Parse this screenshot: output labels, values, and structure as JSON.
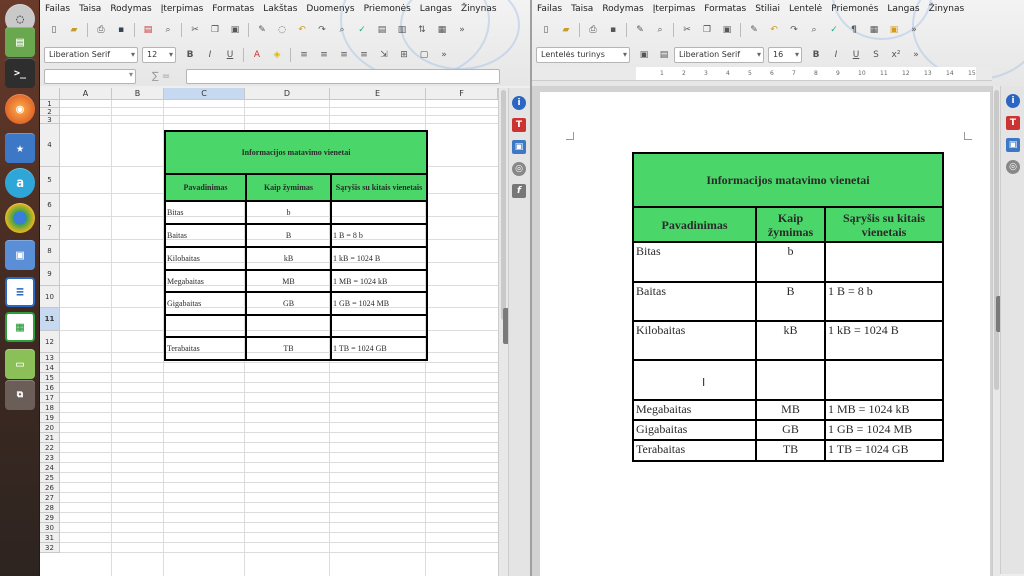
{
  "calc": {
    "menu": [
      "Failas",
      "Taisa",
      "Rodymas",
      "Įterpimas",
      "Formatas",
      "Lakštas",
      "Duomenys",
      "Priemonės",
      "Langas",
      "Žinynas"
    ],
    "font_name": "Liberation Serif",
    "font_size": "12",
    "bold": "B",
    "italic": "I",
    "underline": "U",
    "sigma": "∑",
    "equals": "=",
    "columns": [
      "A",
      "B",
      "C",
      "D",
      "E",
      "F"
    ],
    "rows": [
      "1",
      "2",
      "3",
      "4",
      "5",
      "6",
      "7",
      "8",
      "9",
      "10",
      "11",
      "12",
      "13",
      "14",
      "15",
      "16",
      "17",
      "18",
      "19",
      "20",
      "21",
      "22",
      "23",
      "24",
      "25",
      "26",
      "27",
      "28",
      "29",
      "30",
      "31",
      "32"
    ],
    "selected_row": "11",
    "selected_col": "C",
    "table": {
      "title": "Informacijos matavimo vienetai",
      "headers": [
        "Pavadinimas",
        "Kaip žymimas",
        "Sąryšis su kitais vienetais"
      ],
      "rows": [
        [
          "Bitas",
          "b",
          ""
        ],
        [
          "Baitas",
          "B",
          "1 B = 8 b"
        ],
        [
          "Kilobaitas",
          "kB",
          "1 kB = 1024 B"
        ],
        [
          "Megabaitas",
          "MB",
          "1 MB = 1024 kB"
        ],
        [
          "Gigabaitas",
          "GB",
          "1 GB = 1024 MB"
        ],
        [
          "",
          "",
          ""
        ],
        [
          "Terabaitas",
          "TB",
          "1 TB = 1024 GB"
        ]
      ]
    }
  },
  "writer": {
    "menu": [
      "Failas",
      "Taisa",
      "Rodymas",
      "Įterpimas",
      "Formatas",
      "Stiliai",
      "Lentelė",
      "Priemonės",
      "Langas",
      "Žinynas"
    ],
    "style_name": "Lentelės turinys",
    "font_name": "Liberation Serif",
    "font_size": "16",
    "bold": "B",
    "italic": "I",
    "underline": "U",
    "ruler_numbers": [
      "1",
      "2",
      "3",
      "4",
      "5",
      "6",
      "7",
      "8",
      "9",
      "10",
      "11",
      "12",
      "13",
      "14",
      "15"
    ],
    "table": {
      "title": "Informacijos matavimo vienetai",
      "headers": [
        "Pavadinimas",
        "Kaip žymimas",
        "Sąryšis su kitais vienetais"
      ],
      "rows": [
        [
          "Bitas",
          "b",
          ""
        ],
        [
          "Baitas",
          "B",
          "1 B = 8 b"
        ],
        [
          "Kilobaitas",
          "kB",
          "1 kB = 1024 B"
        ],
        [
          "",
          "",
          ""
        ],
        [
          "Megabaitas",
          "MB",
          "1 MB = 1024 kB"
        ],
        [
          "Gigabaitas",
          "GB",
          "1 GB = 1024 MB"
        ],
        [
          "Terabaitas",
          "TB",
          "1 TB = 1024 GB"
        ]
      ]
    }
  },
  "launcher": {
    "icons": [
      "dash-icon",
      "settings-icon",
      "terminal-icon",
      "firefox-icon",
      "software-center-icon",
      "help-icon",
      "chrome-icon",
      "photos-icon",
      "writer-icon",
      "calc-icon",
      "files-icon",
      "workspace-icon"
    ]
  },
  "sidebar": {
    "icons": [
      "properties-icon",
      "styles-icon",
      "gallery-icon",
      "navigator-icon",
      "functions-icon"
    ]
  },
  "colors": {
    "header_green": "#4bd66a",
    "selection": "#c6d9f0"
  }
}
